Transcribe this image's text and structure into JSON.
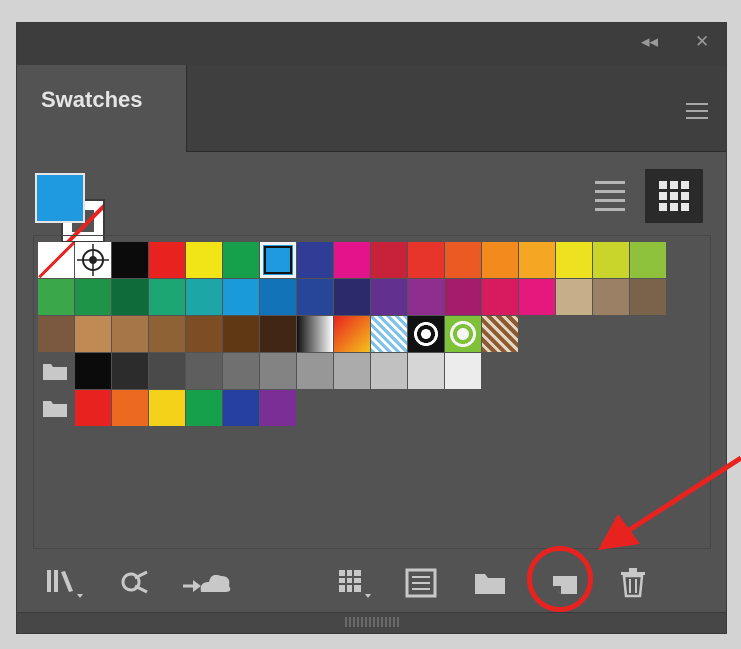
{
  "window": {
    "collapse_glyph": "◂◂",
    "close_glyph": "✕"
  },
  "panel": {
    "tab_label": "Swatches"
  },
  "fill_stroke": {
    "fill_color": "#1f9ae0",
    "stroke": "none"
  },
  "view_modes": [
    {
      "name": "list-view",
      "active": false
    },
    {
      "name": "thumbnail-view",
      "active": true
    }
  ],
  "swatch_rows": [
    {
      "kind": "row",
      "swatches": [
        "none",
        "registration",
        "#0b0b0b",
        "#e8231f",
        "#f1e417",
        "#17a04b",
        "#1f9ae0",
        "#2f3d97",
        "#e3138c",
        "#c8223a",
        "#e8352b",
        "#ec5a24",
        "#f28a1e",
        "#f5a622",
        "#eee120",
        "#c9d52b",
        "#8fc13d"
      ],
      "selected_index": 6
    },
    {
      "kind": "row",
      "swatches": [
        "#3aa84a",
        "#1d9447",
        "#106b3a",
        "#1ba673",
        "#1ca6a5",
        "#1a9ad8",
        "#1373b8",
        "#27469a",
        "#2b2b6b",
        "#62318f",
        "#8e2f8f",
        "#a51c6d",
        "#d81a5f",
        "#e5197d",
        "#c5ae88",
        "#9b8066",
        "#7b624b"
      ]
    },
    {
      "kind": "row",
      "swatches": [
        "#7b5840",
        "#c08a55",
        "#a67646",
        "#8f6236",
        "#7d4e25",
        "#613814",
        "#412613",
        "gradient-bw",
        "gradient-orange",
        "pattern-blue",
        "pattern-circle",
        "pattern-green",
        "pattern-brown"
      ]
    },
    {
      "kind": "group",
      "swatches": [
        "#0b0b0b",
        "#2c2c2c",
        "#4a4a4a",
        "#5e5e5e",
        "#707070",
        "#838383",
        "#979797",
        "#ababab",
        "#c1c1c1",
        "#d6d6d6",
        "#ececec"
      ]
    },
    {
      "kind": "group",
      "swatches": [
        "#e8231f",
        "#ec6a1f",
        "#f5d21a",
        "#17a04b",
        "#2440a0",
        "#7a2e96"
      ]
    }
  ],
  "toolbar": [
    {
      "name": "swatch-libraries-menu-button",
      "icon": "library-icon"
    },
    {
      "name": "show-swatch-kinds-button",
      "icon": "swatch-kinds-icon"
    },
    {
      "name": "libraries-cloud-button",
      "icon": "cloud-icon"
    },
    {
      "name": "swatch-options-button",
      "icon": "grid-options-icon"
    },
    {
      "name": "new-color-group-button",
      "icon": "color-group-icon"
    },
    {
      "name": "new-folder-button",
      "icon": "folder-icon"
    },
    {
      "name": "new-swatch-button",
      "icon": "new-swatch-icon"
    },
    {
      "name": "delete-swatch-button",
      "icon": "trash-icon"
    }
  ],
  "annotation": {
    "color": "#e8231f",
    "highlighted": "new-swatch-button"
  }
}
